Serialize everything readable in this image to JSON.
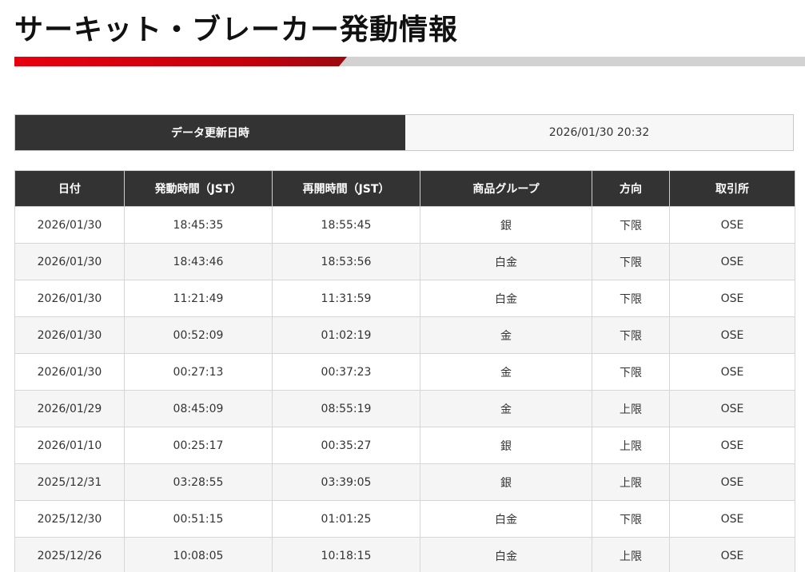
{
  "page": {
    "title": "サーキット・ブレーカー発動情報"
  },
  "colors": {
    "accent_red": "#e8000f",
    "header_dark": "#333333",
    "rule_gray": "#d2d2d2"
  },
  "update": {
    "label": "データ更新日時",
    "value": "2026/01/30 20:32"
  },
  "table": {
    "columns": [
      "日付",
      "発動時間（JST）",
      "再開時間（JST）",
      "商品グループ",
      "方向",
      "取引所"
    ],
    "rows": [
      [
        "2026/01/30",
        "18:45:35",
        "18:55:45",
        "銀",
        "下限",
        "OSE"
      ],
      [
        "2026/01/30",
        "18:43:46",
        "18:53:56",
        "白金",
        "下限",
        "OSE"
      ],
      [
        "2026/01/30",
        "11:21:49",
        "11:31:59",
        "白金",
        "下限",
        "OSE"
      ],
      [
        "2026/01/30",
        "00:52:09",
        "01:02:19",
        "金",
        "下限",
        "OSE"
      ],
      [
        "2026/01/30",
        "00:27:13",
        "00:37:23",
        "金",
        "下限",
        "OSE"
      ],
      [
        "2026/01/29",
        "08:45:09",
        "08:55:19",
        "金",
        "上限",
        "OSE"
      ],
      [
        "2026/01/10",
        "00:25:17",
        "00:35:27",
        "銀",
        "上限",
        "OSE"
      ],
      [
        "2025/12/31",
        "03:28:55",
        "03:39:05",
        "銀",
        "上限",
        "OSE"
      ],
      [
        "2025/12/30",
        "00:51:15",
        "01:01:25",
        "白金",
        "下限",
        "OSE"
      ],
      [
        "2025/12/26",
        "10:08:05",
        "10:18:15",
        "白金",
        "上限",
        "OSE"
      ]
    ]
  }
}
